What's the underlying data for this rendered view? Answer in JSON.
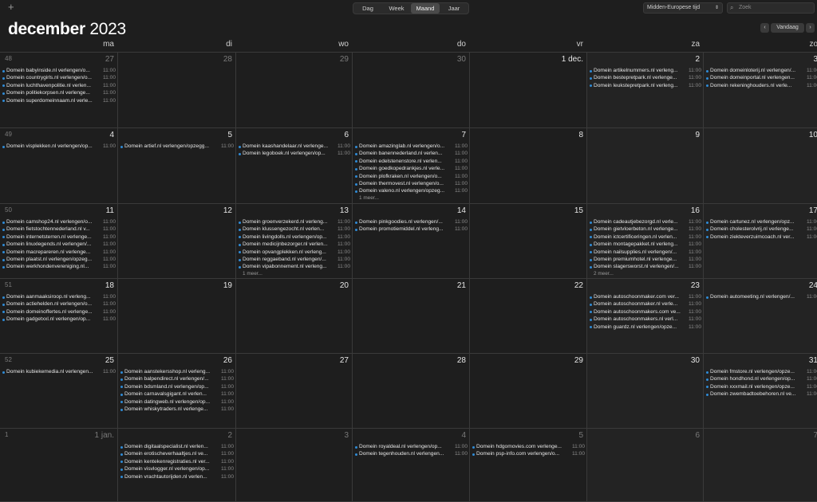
{
  "toolbar": {
    "add_label": "+",
    "views": [
      "Dag",
      "Week",
      "Maand",
      "Jaar"
    ],
    "active_view": "Maand",
    "timezone": "Midden-Europese tijd",
    "search_placeholder": "Zoek",
    "today_label": "Vandaag",
    "prev_label": "‹",
    "next_label": "›"
  },
  "header": {
    "month": "december",
    "year": "2023"
  },
  "weekdays": [
    "ma",
    "di",
    "wo",
    "do",
    "vr",
    "za",
    "zo"
  ],
  "colors": {
    "accent": "#2f8bd6",
    "background": "#1e1e1e"
  },
  "weeks": [
    {
      "week": "48",
      "days": [
        {
          "label": "27",
          "dim": true,
          "events": [
            "Domein babyinside.nl verlengen/o...",
            "Domein countrygirls.nl verlengen/o...",
            "Domein luchthavenpolitie.nl verlen...",
            "Domein politiekorpsen.nl verlenge...",
            "Domein superdomeinnaam.nl verle..."
          ]
        },
        {
          "label": "28",
          "dim": true,
          "events": []
        },
        {
          "label": "29",
          "dim": true,
          "events": []
        },
        {
          "label": "30",
          "dim": true,
          "events": []
        },
        {
          "label": "1 dec.",
          "dim": false,
          "events": []
        },
        {
          "label": "2",
          "dim": false,
          "events": [
            "Domein artikelnummers.nl verleng...",
            "Domein bestepretpark.nl verlenge...",
            "Domein leukstepretpark.nl verleng..."
          ]
        },
        {
          "label": "3",
          "dim": false,
          "events": [
            "Domein domeinloterij.nl verlengen/...",
            "Domein domeinportal.nl verlengen...",
            "Domein rekeninghouders.nl verle..."
          ]
        }
      ]
    },
    {
      "week": "49",
      "days": [
        {
          "label": "4",
          "events": [
            "Domein visplekken.nl verlengen/op..."
          ]
        },
        {
          "label": "5",
          "events": [
            "Domein artief.nl verlengen/opzegg..."
          ]
        },
        {
          "label": "6",
          "events": [
            "Domein kaashandelaar.nl verlenge...",
            "Domein legoboek.nl verlengen/op..."
          ]
        },
        {
          "label": "7",
          "events": [
            "Domein amazinglab.nl verlengen/o...",
            "Domein banennederland.nl verlen...",
            "Domein edelstenenstore.nl verlen...",
            "Domein goedkopedrankjes.nl verle...",
            "Domein plofkraken.nl verlengen/o...",
            "Domein thermovest.nl verlengen/o...",
            "Domein valeno.nl verlengen/opzeg..."
          ],
          "more": "1 meer..."
        },
        {
          "label": "8",
          "events": []
        },
        {
          "label": "9",
          "events": []
        },
        {
          "label": "10",
          "events": []
        }
      ]
    },
    {
      "week": "50",
      "days": [
        {
          "label": "11",
          "events": [
            "Domein camshop24.nl verlengen/o...",
            "Domein fietstochtennederland.nl v...",
            "Domein internetsterren.nl verlenge...",
            "Domein linuxlegends.nl verlengen/...",
            "Domein macrepareren.nl verlenge...",
            "Domein plaatst.nl verlengen/opzeg...",
            "Domein werkhondenvereniging.nl..."
          ]
        },
        {
          "label": "12",
          "events": []
        },
        {
          "label": "13",
          "events": [
            "Domein groenverzekerd.nl verleng...",
            "Domein klussengezocht.nl verlen...",
            "Domein livingdolls.nl verlengen/op...",
            "Domein medicijnbezorger.nl verlen...",
            "Domein opvangplekken.nl verleng...",
            "Domein reggaeband.nl verlengen/...",
            "Domein vipabonnement.nl verleng..."
          ],
          "more": "1 meer..."
        },
        {
          "label": "14",
          "events": [
            "Domein pinkgoodies.nl verlengen/...",
            "Domein promotiemiddel.nl verleng..."
          ]
        },
        {
          "label": "15",
          "events": []
        },
        {
          "label": "16",
          "events": [
            "Domein cadeautjebezorgd.nl verle...",
            "Domein gietvloerbeton.nl verlenge...",
            "Domein ictcertificeringen.nl verlen...",
            "Domein montagepakket.nl verleng...",
            "Domein nailsupplies.nl verlengen/...",
            "Domein premiumhotel.nl verlenge...",
            "Domein slagersworst.nl verlengen/..."
          ],
          "more": "2 meer..."
        },
        {
          "label": "17",
          "events": [
            "Domein cartunez.nl verlengen/opz...",
            "Domein cholesterolvrij.nl verlenge...",
            "Domein ziekteverzuimcoach.nl ver..."
          ]
        }
      ]
    },
    {
      "week": "51",
      "days": [
        {
          "label": "18",
          "events": [
            "Domein aanmaaksiroop.nl verleng...",
            "Domein actiehelden.nl verlengen/o...",
            "Domein domeinoffertes.nl verlenge...",
            "Domein gadgetxxl.nl verlengen/op..."
          ]
        },
        {
          "label": "19",
          "events": []
        },
        {
          "label": "20",
          "events": []
        },
        {
          "label": "21",
          "events": []
        },
        {
          "label": "22",
          "events": []
        },
        {
          "label": "23",
          "events": [
            "Domein autoschoonmaker.com ver...",
            "Domein autoschoonmaker.nl verle...",
            "Domein autoschoonmakers.com ve...",
            "Domein autoschoonmakers.nl verl...",
            "Domein guardz.nl verlengen/opze..."
          ]
        },
        {
          "label": "24",
          "events": [
            "Domein automeeting.nl verlengen/..."
          ]
        }
      ]
    },
    {
      "week": "52",
      "days": [
        {
          "label": "25",
          "events": [
            "Domein kubiekemedia.nl verlengen..."
          ]
        },
        {
          "label": "26",
          "events": [
            "Domein aanstekersshop.nl verleng...",
            "Domein balpendirect.nl verlengen/...",
            "Domein bdsmland.nl verlengen/op...",
            "Domein carnavalsgigant.nl verlen...",
            "Domein datingweb.nl verlengen/op...",
            "Domein whiskytraders.nl verlenge..."
          ]
        },
        {
          "label": "27",
          "events": []
        },
        {
          "label": "28",
          "events": []
        },
        {
          "label": "29",
          "events": []
        },
        {
          "label": "30",
          "events": []
        },
        {
          "label": "31",
          "events": [
            "Domein fmstore.nl verlengen/opze...",
            "Domein hondhond.nl verlengen/op...",
            "Domein xxxmail.nl verlengen/opze...",
            "Domein zwembadtoebehoren.nl ve..."
          ]
        }
      ]
    },
    {
      "week": "1",
      "days": [
        {
          "label": "1 jan.",
          "dim": true,
          "events": []
        },
        {
          "label": "2",
          "dim": true,
          "events": [
            "Domein digitaalspecialist.nl verlen...",
            "Domein erotischeverhaaltjes.nl ve...",
            "Domein kentekenregistraties.nl ver...",
            "Domein visvlogger.nl verlengen/op...",
            "Domein vrachtautorijden.nl verlen..."
          ]
        },
        {
          "label": "3",
          "dim": true,
          "events": []
        },
        {
          "label": "4",
          "dim": true,
          "events": [
            "Domein royaldeal.nl verlengen/op...",
            "Domein tegenhouden.nl verlengen..."
          ]
        },
        {
          "label": "5",
          "dim": true,
          "events": [
            "Domein hdgomovies.com verlenge...",
            "Domein psp-info.com verlengen/o..."
          ]
        },
        {
          "label": "6",
          "dim": true,
          "events": []
        },
        {
          "label": "7",
          "dim": true,
          "events": []
        }
      ]
    }
  ],
  "event_time": "11:00"
}
